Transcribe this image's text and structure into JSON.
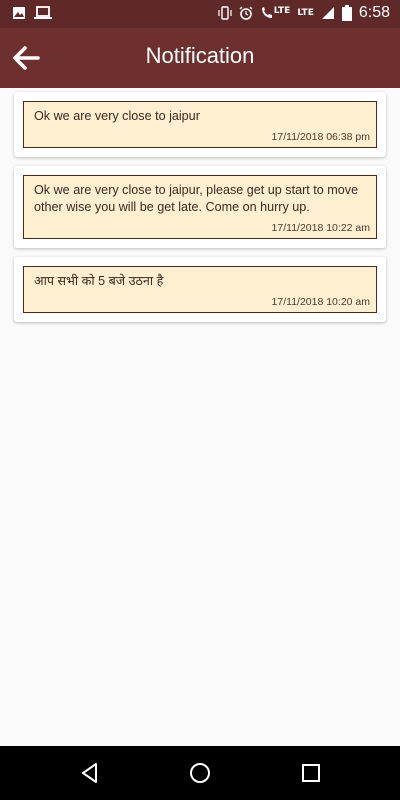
{
  "status_bar": {
    "time": "6:58",
    "lte_1": "LTE",
    "lte_2": "LTE"
  },
  "header": {
    "title": "Notification"
  },
  "notifications": [
    {
      "message": "Ok we are very close to jaipur",
      "timestamp": "17/11/2018 06:38 pm"
    },
    {
      "message": "Ok we are very close to jaipur, please get up start to move other wise you will be get late. Come on hurry up.",
      "timestamp": "17/11/2018 10:22 am"
    },
    {
      "message": "आप सभी को 5 बजे उठना है",
      "timestamp": "17/11/2018 10:20 am"
    }
  ],
  "colors": {
    "status_bar": "#5f2929",
    "app_bar": "#6e2f2f",
    "note_background": "#fdefd0",
    "note_border": "#4a2a1f"
  },
  "icons": {
    "status_left": [
      "image-icon",
      "laptop-icon"
    ],
    "status_right": [
      "vibrate-icon",
      "alarm-icon",
      "wifi-call-icon",
      "signal-icon",
      "battery-icon"
    ],
    "nav": [
      "back-triangle-icon",
      "home-circle-icon",
      "recents-square-icon"
    ]
  }
}
